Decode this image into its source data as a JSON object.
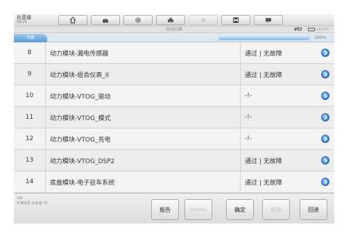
{
  "brand": {
    "name": "比亚迪",
    "version": "V9.20"
  },
  "toolbar": {
    "buttons": [
      {
        "icon": "home-icon",
        "enabled": true
      },
      {
        "icon": "car-icon",
        "enabled": true
      },
      {
        "icon": "gear-icon",
        "enabled": true
      },
      {
        "icon": "printer-icon",
        "enabled": true
      },
      {
        "icon": "camera-icon",
        "enabled": false
      },
      {
        "icon": "save-icon",
        "enabled": true
      },
      {
        "icon": "message-icon",
        "enabled": true
      }
    ]
  },
  "status": {
    "title": "自动扫描",
    "vci_label": "VCI",
    "battery": "14.07V"
  },
  "list": {
    "tab_label": "列表",
    "progress_percent": 100,
    "progress_label": "100%"
  },
  "rows": [
    {
      "num": "8",
      "name": "动力模块-漏电传感器",
      "result": "通过 | 无故障"
    },
    {
      "num": "9",
      "name": "动力模块-组合仪表_II",
      "result": "通过 | 无故障"
    },
    {
      "num": "10",
      "name": "动力模块-VTOG_驱动",
      "result": "-!-"
    },
    {
      "num": "11",
      "name": "动力模块-VTOG_模式",
      "result": "-!-"
    },
    {
      "num": "12",
      "name": "动力模块-VTOG_充电",
      "result": "-!-"
    },
    {
      "num": "13",
      "name": "动力模块-VTOG_DSP2",
      "result": "通过 | 无故障"
    },
    {
      "num": "14",
      "name": "底盘模块-电子驻车系统",
      "result": "通过 | 无故障"
    }
  ],
  "bottom": {
    "vin_label": "VIN",
    "vehicle_info": "车辆信息 比亚迪 V5",
    "buttons": [
      {
        "label": "报告",
        "enabled": true
      },
      {
        "label": "清除故障码",
        "enabled": false
      },
      {
        "label": "确定",
        "enabled": true
      },
      {
        "label": "暂停",
        "enabled": false
      },
      {
        "label": "回退",
        "enabled": true
      }
    ]
  },
  "colors": {
    "accent": "#5a9ad5",
    "arrow": "#3f88da"
  }
}
